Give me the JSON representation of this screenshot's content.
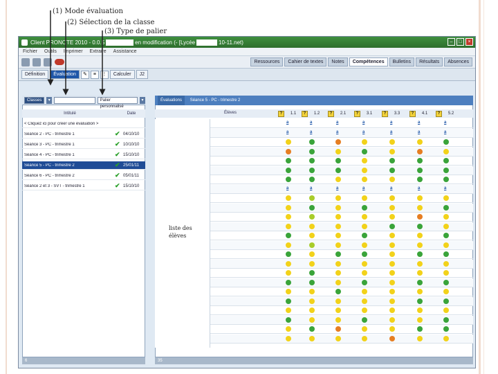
{
  "callouts": {
    "mode": "(1) Mode évaluation",
    "classe": "(2) Sélection de la classe",
    "palier": "(3) Type de palier",
    "liste": "liste des élèves"
  },
  "window": {
    "title_prefix": "Client PRONOTE",
    "title_version": "2010 - 0.0.5",
    "title_middle": "en modification",
    "title_lycee": "(- [Lycée",
    "title_suffix": "10-11.net)",
    "buttons": [
      "–",
      "□",
      "×"
    ]
  },
  "menu": [
    "Fichier",
    "Outils",
    "Imprimer",
    "Extraire",
    "Assistance"
  ],
  "main_tabs": [
    "Ressources",
    "Cahier de textes",
    "Notes",
    "Compétences",
    "Bulletins",
    "Résultats",
    "Absences"
  ],
  "main_tabs_active": "Compétences",
  "sub_tabs": [
    "Définition",
    "Évaluation",
    "Calculer",
    "J2"
  ],
  "sub_tabs_active": "Évaluation",
  "filters": {
    "classes_label": "Classes",
    "palier_label": "Palier personnalisé",
    "evaluations_label": "Évaluations"
  },
  "eval_list": {
    "headers": {
      "name": "Intitulé",
      "date": "Date"
    },
    "create_row": "< Cliquez ici pour créer une évaluation >",
    "rows": [
      {
        "name": "Séance 2 - PC - trimestre 1",
        "date": "04/10/10",
        "selected": false
      },
      {
        "name": "Séance 3 - PC - trimestre 1",
        "date": "10/10/10",
        "selected": false
      },
      {
        "name": "Séance 4 - PC - trimestre 1",
        "date": "15/10/10",
        "selected": false
      },
      {
        "name": "Séance 5 - PC - trimestre 2",
        "date": "25/01/11",
        "selected": true
      },
      {
        "name": "Séance 6 - PC - trimestre 2",
        "date": "05/01/11",
        "selected": false
      },
      {
        "name": "Séance 2 et 3 - SVT - trimestre 1",
        "date": "15/10/10",
        "selected": false
      }
    ]
  },
  "grid": {
    "title_tag": "Évaluations",
    "title": "Séance 5 - PC - trimestre 2",
    "eleves_header": "Élèves",
    "columns": [
      "1.1",
      "1.2",
      "2.1",
      "3.1",
      "3.3",
      "4.1",
      "5.2"
    ],
    "colors": {
      "green": "#3aa43a",
      "yellow": "#f2d21a",
      "orange": "#e67e22",
      "lime": "#a8cc2a"
    }
  },
  "status": {
    "left_count": "6",
    "right_count": "35"
  }
}
